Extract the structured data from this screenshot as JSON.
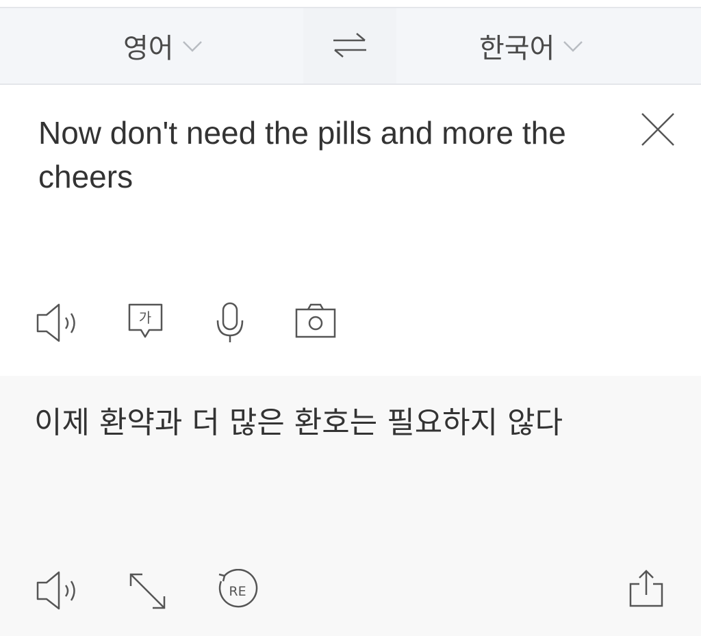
{
  "language_bar": {
    "source_language": "영어",
    "target_language": "한국어",
    "source_chevron_icon": "chevron-down-icon",
    "target_chevron_icon": "chevron-down-icon",
    "swap_icon": "swap-arrows-icon"
  },
  "source": {
    "text": "Now don't need the pills and more the cheers",
    "clear_icon": "close-icon",
    "tools": [
      "speaker-icon",
      "text-bubble-icon",
      "microphone-icon",
      "camera-icon"
    ],
    "text_bubble_glyph": "가"
  },
  "target": {
    "text": "이제 환약과 더 많은 환호는 필요하지 않다",
    "tools": [
      "speaker-icon",
      "expand-icon",
      "retranslate-icon",
      "share-icon"
    ],
    "retranslate_glyph": "RE"
  },
  "colors": {
    "top_bar_background": "#f4f6f9",
    "target_background": "#f8f8f8",
    "icon_stroke": "#555555"
  }
}
